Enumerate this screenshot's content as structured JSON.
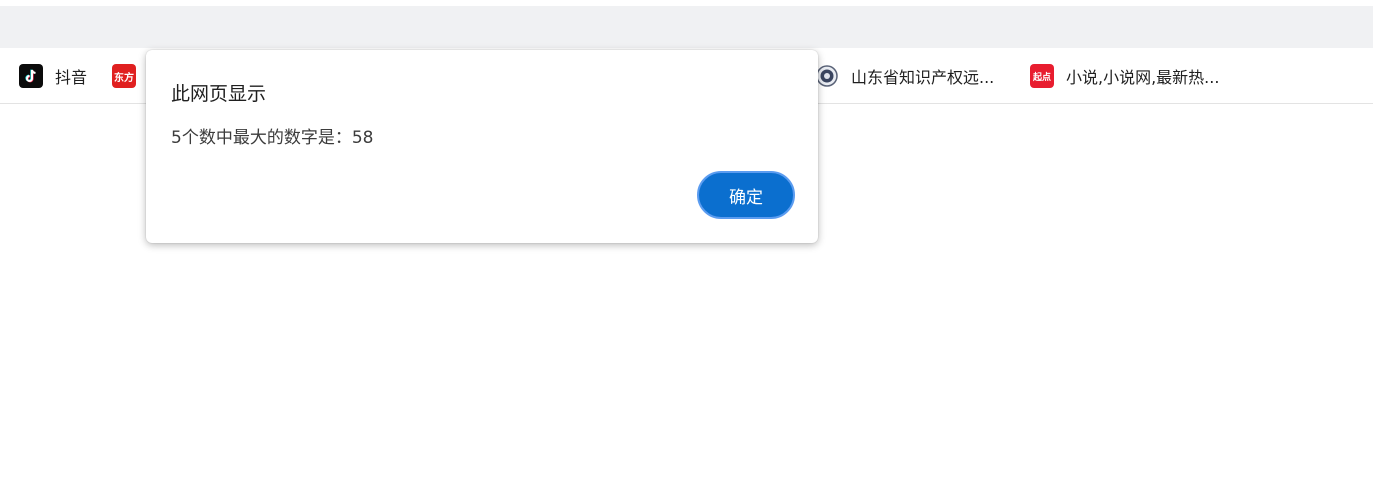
{
  "bookmarks": [
    {
      "label": "抖音",
      "icon": "tiktok-icon"
    },
    {
      "label": "",
      "icon_text": "东方",
      "icon": "dongfang-icon"
    },
    {
      "label": "山东省知识产权远...",
      "icon": "seal-icon"
    },
    {
      "label": "小说,小说网,最新热...",
      "icon_text": "起点",
      "icon": "qidian-icon"
    }
  ],
  "dialog": {
    "title": "此网页显示",
    "message": "5个数中最大的数字是：58",
    "ok_label": "确定"
  },
  "colors": {
    "toolbar": "#f0f1f3",
    "button": "#0b6fcf",
    "button_border": "#5b9cf0"
  }
}
